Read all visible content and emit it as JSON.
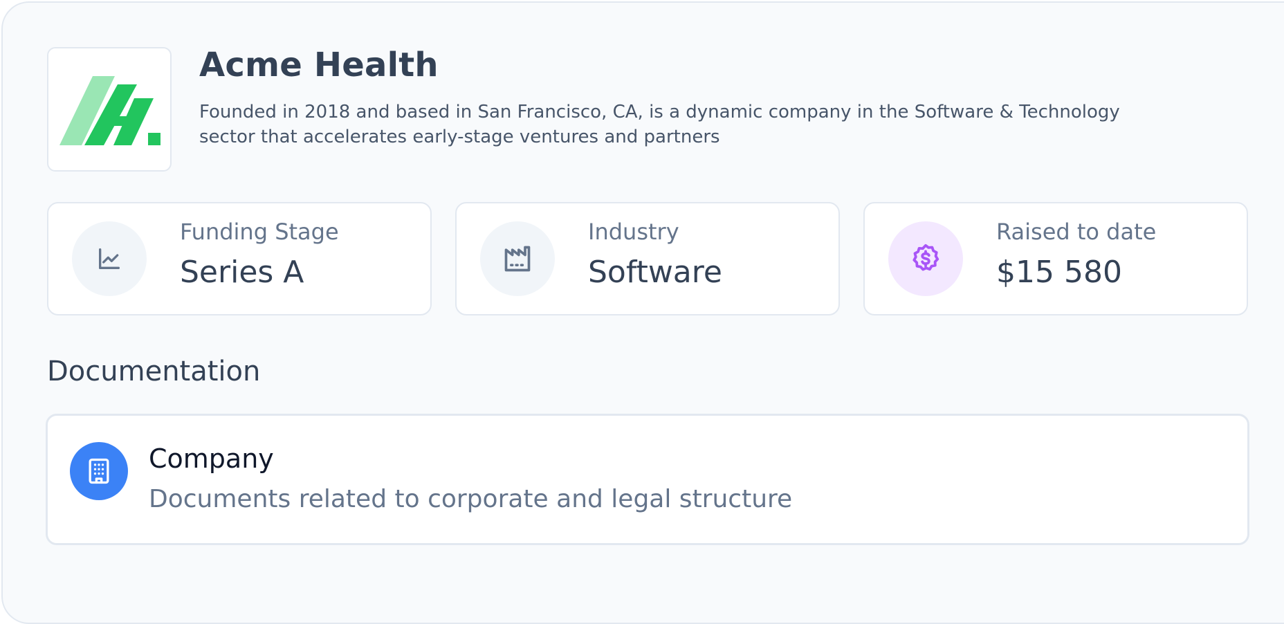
{
  "company": {
    "name": "Acme Health",
    "description": "Founded in 2018 and based in San Francisco, CA, is a dynamic company in the Software & Technology sector that accelerates early-stage ventures and partners",
    "logo_icon": "acme-health-logo",
    "logo_colors": [
      "#9ae6b4",
      "#22c55e"
    ]
  },
  "stats": [
    {
      "label": "Funding Stage",
      "value": "Series A",
      "icon": "chart-line-icon",
      "icon_bg": "#f1f5f9",
      "icon_color": "#64748b"
    },
    {
      "label": "Industry",
      "value": "Software",
      "icon": "factory-icon",
      "icon_bg": "#f1f5f9",
      "icon_color": "#64748b"
    },
    {
      "label": "Raised to date",
      "value": "$15 580",
      "icon": "dollar-badge-icon",
      "icon_bg": "#f3e8ff",
      "icon_color": "#a855f7"
    }
  ],
  "documentation": {
    "title": "Documentation",
    "items": [
      {
        "title": "Company",
        "description": "Documents related to corporate and legal structure",
        "icon": "building-icon",
        "icon_bg": "#3b82f6"
      }
    ]
  }
}
